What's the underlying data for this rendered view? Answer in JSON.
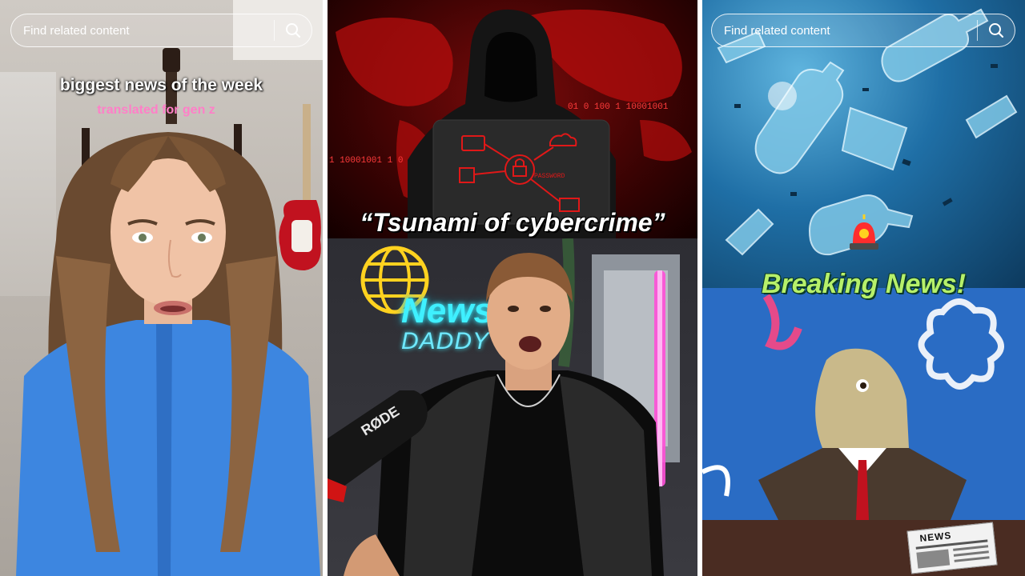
{
  "panels": {
    "left": {
      "search_placeholder": "Find related content",
      "caption_main": "biggest news of the week",
      "caption_sub": "translated for gen z"
    },
    "middle": {
      "caption": "“Tsunami of cybercrime”",
      "binary_line_1": "01 0 100 1 10001001",
      "binary_line_2": "1 10001001 1 0 1",
      "laptop_label": "PASSWORD",
      "neon_sign_top": "News",
      "neon_sign_bottom": "DADDY",
      "mic_brand": "RØDE"
    },
    "right": {
      "search_placeholder": "Find related content",
      "caption": "Breaking News!",
      "newspaper_label": "NEWS"
    }
  },
  "colors": {
    "caption_sub_pink": "#ff7fc8",
    "breaking_green": "#b6f06a",
    "hacker_red": "#d11414",
    "neon_cyan": "#3ff0ff",
    "neon_yellow": "#ffd21f"
  },
  "icons": [
    "search-icon",
    "globe-icon",
    "siren-icon",
    "lock-icon",
    "cloud-icon",
    "mail-icon",
    "card-icon"
  ]
}
